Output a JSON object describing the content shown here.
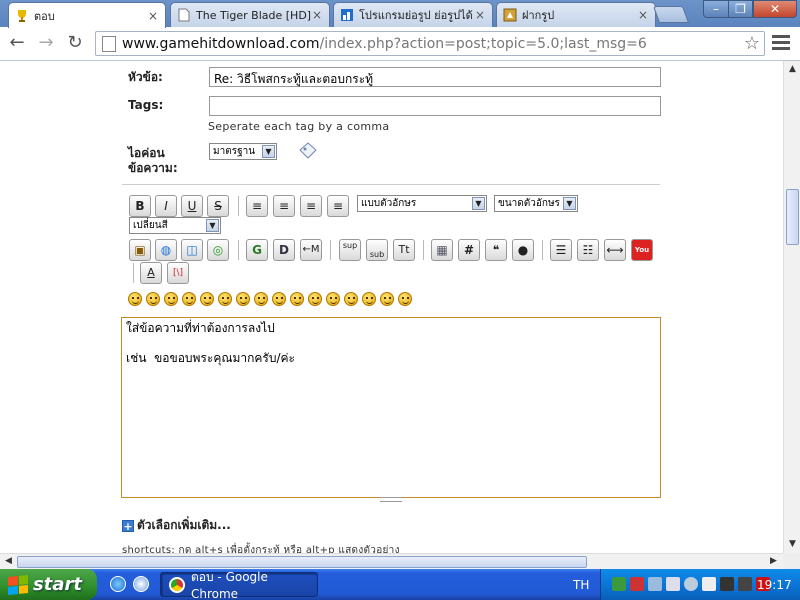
{
  "window": {
    "tabs": [
      {
        "label": "ตอบ",
        "active": true,
        "icon": "trophy-icon"
      },
      {
        "label": "The Tiger Blade [HD] (",
        "active": false,
        "icon": "page-icon"
      },
      {
        "label": "โปรแกรมย่อรูป ย่อรูปได้",
        "active": false,
        "icon": "site-icon"
      },
      {
        "label": "ฝากรูป",
        "active": false,
        "icon": "image-host-icon"
      }
    ],
    "tab_close_glyph": "×",
    "controls": {
      "minimize": "–",
      "maximize": "❐",
      "close": "✕"
    }
  },
  "toolbar": {
    "back_glyph": "←",
    "forward_glyph": "→",
    "reload_glyph": "↻",
    "url_host": "www.gamehitdownload.com",
    "url_path": "/index.php?action=post;topic=5.0;last_msg=6",
    "star_glyph": "☆"
  },
  "form": {
    "subject_label": "หัวข้อ:",
    "subject_value": "Re: วิธีโพสกระทู้และตอบกระทู้",
    "tags_label": "Tags:",
    "tags_value": "",
    "tags_hint": "Seperate each tag by a comma",
    "icon_label_line1": "ไอค่อน",
    "icon_label_line2": "ข้อความ:",
    "icon_select_value": "มาตรฐาน"
  },
  "editor_toolbar": {
    "row1": [
      {
        "name": "bold-button",
        "glyph": "B"
      },
      {
        "name": "italic-button",
        "glyph": "I"
      },
      {
        "name": "underline-button",
        "glyph": "U"
      },
      {
        "name": "strikethrough-button",
        "glyph": "S"
      }
    ],
    "align": [
      {
        "name": "align-left-button",
        "glyph": "≡"
      },
      {
        "name": "align-justify-button",
        "glyph": "≡"
      },
      {
        "name": "align-center-button",
        "glyph": "≡"
      },
      {
        "name": "align-right-button",
        "glyph": "≡"
      }
    ],
    "font_face_value": "แบบตัวอักษร",
    "font_size_value": "ขนาดตัวอักษร",
    "color_value": "เปลี่ยนสี",
    "row2": [
      {
        "name": "insert-image-button",
        "glyph": "▣"
      },
      {
        "name": "insert-link-button",
        "glyph": "◍"
      },
      {
        "name": "insert-flash-button",
        "glyph": "◫"
      },
      {
        "name": "insert-ftp-button",
        "glyph": "◎"
      },
      {
        "name": "glow-button",
        "glyph": "G"
      },
      {
        "name": "shadow-button",
        "glyph": "D"
      },
      {
        "name": "marquee-button",
        "glyph": "←M"
      },
      {
        "name": "superscript-button",
        "glyph": "sup"
      },
      {
        "name": "subscript-button",
        "glyph": "sub"
      },
      {
        "name": "teletype-button",
        "glyph": "Tt"
      },
      {
        "name": "table-button",
        "glyph": "▦"
      },
      {
        "name": "code-button",
        "glyph": "#"
      },
      {
        "name": "quote-button",
        "glyph": "❝"
      },
      {
        "name": "insert-email-button",
        "glyph": "●"
      },
      {
        "name": "unordered-list-button",
        "glyph": "☰"
      },
      {
        "name": "ordered-list-button",
        "glyph": "☷"
      },
      {
        "name": "horizontal-rule-button",
        "glyph": "⟷"
      },
      {
        "name": "youtube-button",
        "glyph": "You"
      },
      {
        "name": "toggle-view-button",
        "glyph": "A"
      },
      {
        "name": "remove-format-button",
        "glyph": "[\\]"
      }
    ]
  },
  "editor": {
    "text": "ใส่ข้อความที่ท่าต้องการลงไป\n\nเช่น  ขอขอบพระคุณมากครับ/ค่ะ"
  },
  "more_options": {
    "plus_glyph": "+",
    "label": "ตัวเลือกเพิ่มเติม..."
  },
  "shortcuts": "shortcuts: กด alt+s เพื่อตั้งกระทู้ หรือ alt+p แสดงตัวอย่าง",
  "scroll": {
    "up": "▲",
    "down": "▼",
    "left": "◀",
    "right": "▶"
  },
  "taskbar": {
    "start_label": "start",
    "task_label": "ตอบ - Google Chrome",
    "lang": "TH",
    "clock": "19:17"
  }
}
